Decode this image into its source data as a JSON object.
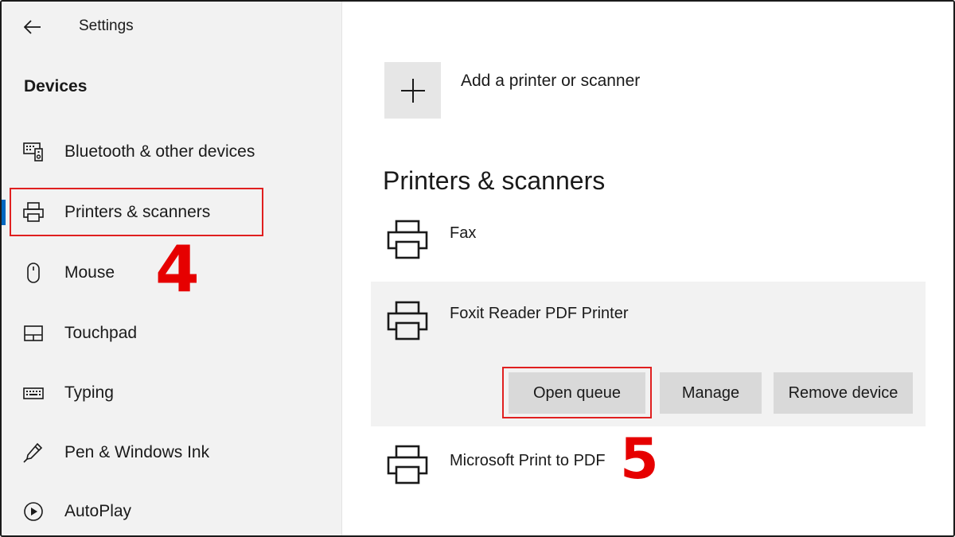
{
  "app": {
    "title": "Settings"
  },
  "sidebar": {
    "section_title": "Devices",
    "items": [
      {
        "label": "Bluetooth & other devices",
        "icon": "bluetooth-devices-icon"
      },
      {
        "label": "Printers & scanners",
        "icon": "printer-icon",
        "selected": true
      },
      {
        "label": "Mouse",
        "icon": "mouse-icon"
      },
      {
        "label": "Touchpad",
        "icon": "touchpad-icon"
      },
      {
        "label": "Typing",
        "icon": "keyboard-icon"
      },
      {
        "label": "Pen & Windows Ink",
        "icon": "pen-icon"
      },
      {
        "label": "AutoPlay",
        "icon": "autoplay-icon"
      }
    ]
  },
  "main": {
    "add_label": "Add a printer or scanner",
    "heading": "Printers & scanners",
    "printers": [
      {
        "name": "Fax"
      },
      {
        "name": "Foxit Reader PDF Printer",
        "expanded": true
      },
      {
        "name": "Microsoft Print to PDF"
      }
    ],
    "actions": {
      "open_queue": "Open queue",
      "manage": "Manage",
      "remove": "Remove device"
    }
  },
  "annotations": {
    "step_4": "4",
    "step_5": "5",
    "highlight_color": "#e60000"
  },
  "colors": {
    "accent": "#0067c0",
    "sidebar_bg": "#f2f2f2",
    "button_bg": "#d9d9d9"
  }
}
